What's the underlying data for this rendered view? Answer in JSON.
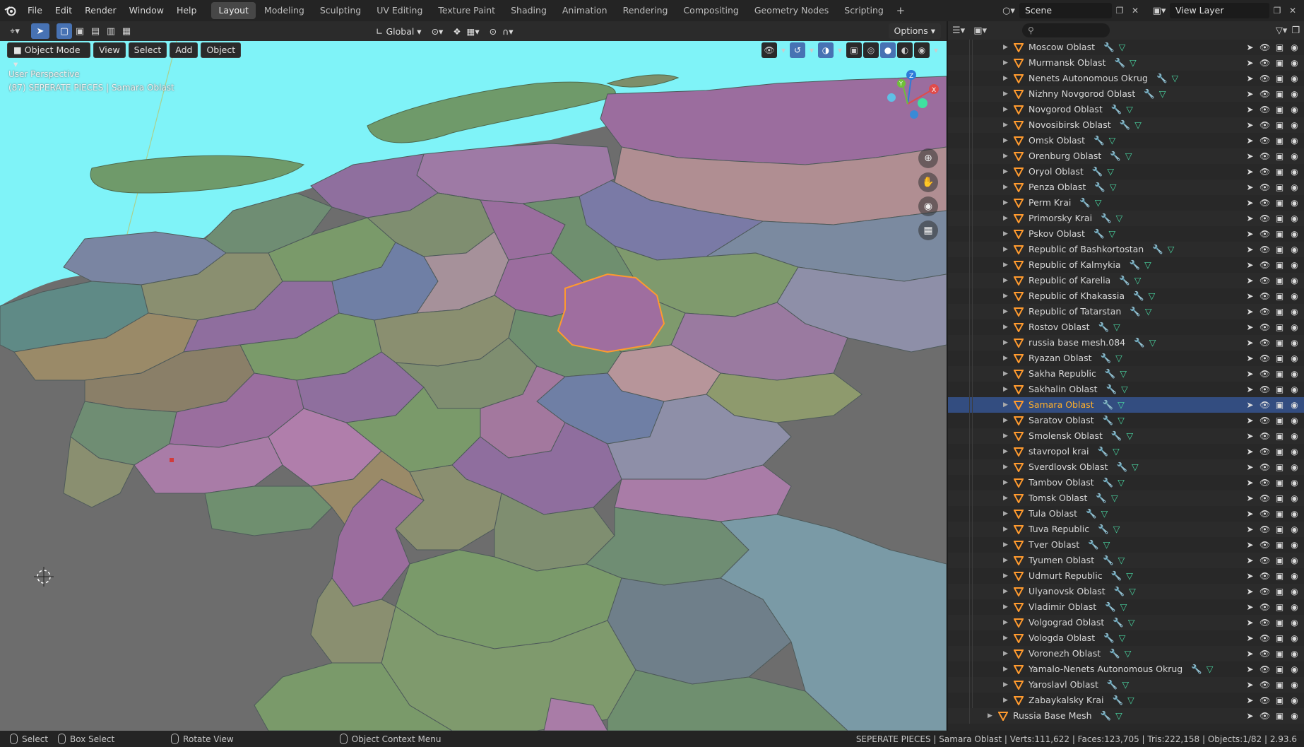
{
  "app": {
    "menu": [
      "File",
      "Edit",
      "Render",
      "Window",
      "Help"
    ],
    "workspaces": [
      "Layout",
      "Modeling",
      "Sculpting",
      "UV Editing",
      "Texture Paint",
      "Shading",
      "Animation",
      "Rendering",
      "Compositing",
      "Geometry Nodes",
      "Scripting"
    ],
    "active_workspace": "Layout",
    "scene": "Scene",
    "view_layer": "View Layer"
  },
  "viewport": {
    "transform_orientation": "Global",
    "options_label": "Options",
    "mode": "Object Mode",
    "menus": [
      "View",
      "Select",
      "Add",
      "Object"
    ],
    "overlay_line1": "User Perspective",
    "overlay_line2": "(87) SEPERATE PIECES | Samara Oblast",
    "background_color": "#7ff3f8",
    "selected_outline_color": "#ff9a2e"
  },
  "outliner": {
    "items": [
      "Moscow Oblast",
      "Murmansk Oblast",
      "Nenets Autonomous Okrug",
      "Nizhny Novgorod Oblast",
      "Novgorod Oblast",
      "Novosibirsk Oblast",
      "Omsk Oblast",
      "Orenburg Oblast",
      "Oryol Oblast",
      "Penza Oblast",
      "Perm Krai",
      "Primorsky Krai",
      "Pskov Oblast",
      "Republic of Bashkortostan",
      "Republic of Kalmykia",
      "Republic of Karelia",
      "Republic of Khakassia",
      "Republic of Tatarstan",
      "Rostov Oblast",
      "russia base mesh.084",
      "Ryazan Oblast",
      "Sakha Republic",
      "Sakhalin Oblast",
      "Samara Oblast",
      "Saratov Oblast",
      "Smolensk Oblast",
      "stavropol krai",
      "Sverdlovsk Oblast",
      "Tambov Oblast",
      "Tomsk Oblast",
      "Tula Oblast",
      "Tuva Republic",
      "Tver Oblast",
      "Tyumen Oblast",
      "Udmurt Republic",
      "Ulyanovsk Oblast",
      "Vladimir Oblast",
      "Volgograd Oblast",
      "Vologda Oblast",
      "Voronezh Oblast",
      "Yamalo-Nenets Autonomous Okrug",
      "Yaroslavl Oblast",
      "Zabaykalsky Krai"
    ],
    "selected": "Samara Oblast",
    "root_item": "Russia Base Mesh"
  },
  "statusbar": {
    "select": "Select",
    "box_select": "Box Select",
    "rotate_view": "Rotate View",
    "context_menu": "Object Context Menu",
    "stats": "SEPERATE PIECES | Samara Oblast | Verts:111,622 | Faces:123,705 | Tris:222,158 | Objects:1/82 | 2.93.6"
  },
  "colors": {
    "accent": "#4772b3",
    "object_icon": "#ff9a2e",
    "selected_text": "#ffaf29"
  }
}
